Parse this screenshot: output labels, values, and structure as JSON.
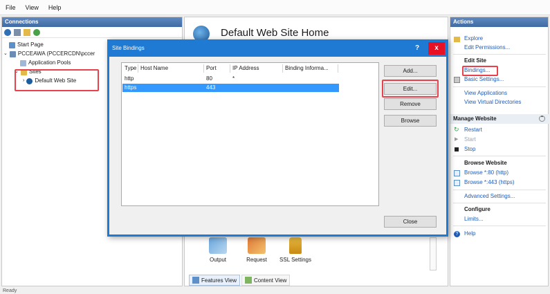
{
  "menu": {
    "file": "File",
    "view": "View",
    "help": "Help"
  },
  "connections": {
    "header": "Connections",
    "tree": {
      "start_page": "Start Page",
      "server": "PCCEAWA (PCCERCDN\\pccer",
      "app_pools": "Application Pools",
      "sites": "Sites",
      "default_site": "Default Web Site"
    }
  },
  "center": {
    "title": "Default Web Site Home",
    "features": [
      "Output",
      "Request",
      "SSL Settings"
    ],
    "tabs": {
      "features_view": "Features View",
      "content_view": "Content View"
    }
  },
  "dialog": {
    "title": "Site Bindings",
    "help_btn": "?",
    "close_btn": "x",
    "columns": [
      "Type",
      "Host Name",
      "Port",
      "IP Address",
      "Binding Informa..."
    ],
    "rows": [
      {
        "type": "http",
        "host": "",
        "port": "80",
        "ip": "*",
        "info": ""
      },
      {
        "type": "https",
        "host": "",
        "port": "443",
        "ip": "",
        "info": ""
      }
    ],
    "buttons": {
      "add": "Add...",
      "edit": "Edit...",
      "remove": "Remove",
      "browse": "Browse",
      "close": "Close"
    }
  },
  "actions": {
    "header": "Actions",
    "explore": "Explore",
    "edit_permissions": "Edit Permissions...",
    "edit_site": "Edit Site",
    "bindings": "Bindings...",
    "basic_settings": "Basic Settings...",
    "view_applications": "View Applications",
    "view_virtual_dirs": "View Virtual Directories",
    "manage_website": "Manage Website",
    "restart": "Restart",
    "start": "Start",
    "stop": "Stop",
    "browse_website": "Browse Website",
    "browse_http": "Browse *:80 (http)",
    "browse_https": "Browse *:443 (https)",
    "advanced_settings": "Advanced Settings...",
    "configure": "Configure",
    "limits": "Limits...",
    "help": "Help"
  },
  "status": {
    "text": "Ready"
  },
  "colors": {
    "accent": "#1f7ad3",
    "highlight": "#e8414b",
    "selection": "#3399ff",
    "link": "#1f5bb5"
  }
}
